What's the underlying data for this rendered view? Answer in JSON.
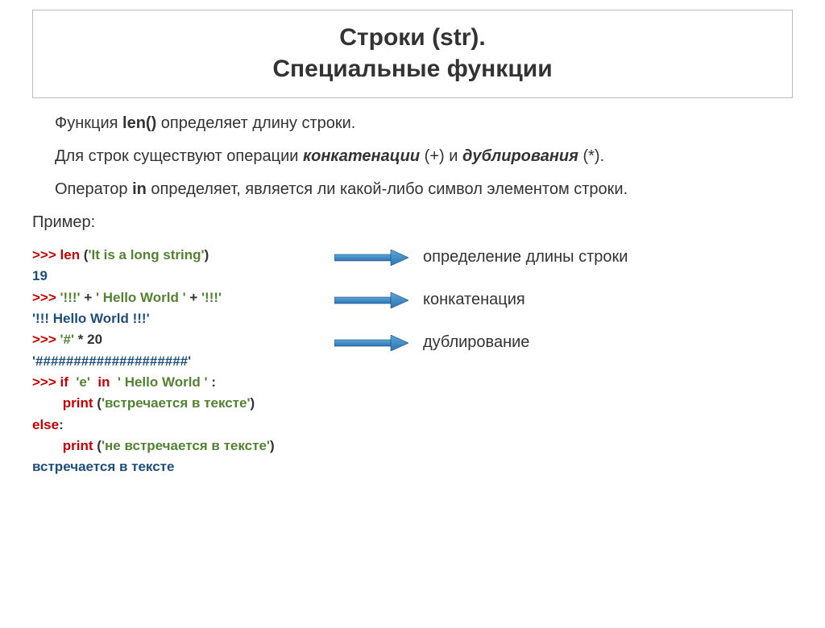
{
  "title": {
    "line1": "Строки (str).",
    "line2": "Специальные функции"
  },
  "para1": {
    "pre": "Функция ",
    "strong": "len()",
    "post": " определяет длину строки."
  },
  "para2": {
    "pre": "Для строк существуют операции ",
    "em1": "конкатенации",
    "mid": " (+) и ",
    "em2": "дублирования",
    "post": " (*)."
  },
  "para3": {
    "pre": "Оператор ",
    "strong": "in",
    "post": " определяет, является ли какой-либо символ элементом строки."
  },
  "example_label": "Пример:",
  "code": {
    "l1_prompt": ">>> ",
    "l1_kw": "len",
    "l1_paren_open": " (",
    "l1_str": "'It is a long string'",
    "l1_paren_close": ")",
    "l2": "19",
    "l3_prompt": ">>> ",
    "l3_s1": "'!!!'",
    "l3_plus1": " + ",
    "l3_s2": "' Hello World '",
    "l3_plus2": " + ",
    "l3_s3": "'!!!'",
    "l4": "'!!! Hello World !!!'",
    "l5_prompt": ">>> ",
    "l5_s": "'#'",
    "l5_op": " * ",
    "l5_n": "20",
    "l6": "'####################'",
    "l7_prompt": ">>> ",
    "l7_kw": "if",
    "l7_sp1": "  ",
    "l7_s1": "'e'",
    "l7_sp2": "  ",
    "l7_in": "in",
    "l7_sp3": "  ",
    "l7_s2": "' Hello World '",
    "l7_colon": " :",
    "l8_indent": "        ",
    "l8_kw": "print",
    "l8_open": " (",
    "l8_str": "'встречается в тексте'",
    "l8_close": ")",
    "l9_kw": "else",
    "l9_colon": ":",
    "l10_indent": "        ",
    "l10_kw": "print",
    "l10_open": " (",
    "l10_str": "'не встречается в тексте'",
    "l10_close": ")",
    "l11": "встречается в тексте"
  },
  "annotations": {
    "a1": "определение длины строки",
    "a2": "конкатенация",
    "a3": "дублирование"
  },
  "arrow_svg": "arrow"
}
